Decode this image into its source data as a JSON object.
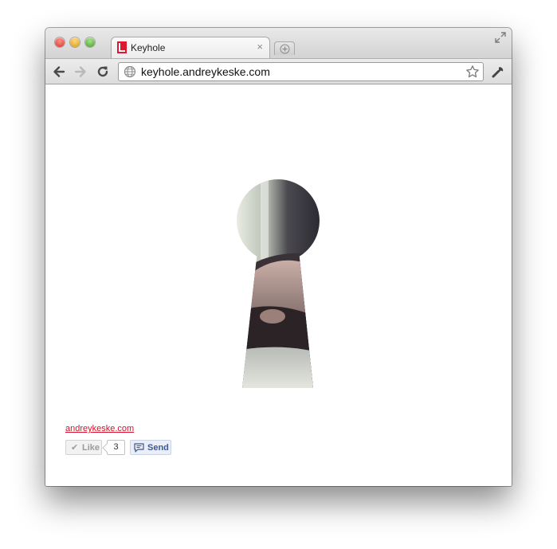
{
  "tab": {
    "title": "Keyhole",
    "close": "×"
  },
  "toolbar": {
    "url": "keyhole.andreykeske.com"
  },
  "page": {
    "site_link": "andreykeske.com"
  },
  "facebook": {
    "like_label": "Like",
    "like_check": "✔",
    "like_count": "3",
    "send_label": "Send"
  },
  "colors": {
    "link": "#d6102a",
    "facebook_blue": "#3b5998",
    "favicon_red": "#e0182f"
  }
}
